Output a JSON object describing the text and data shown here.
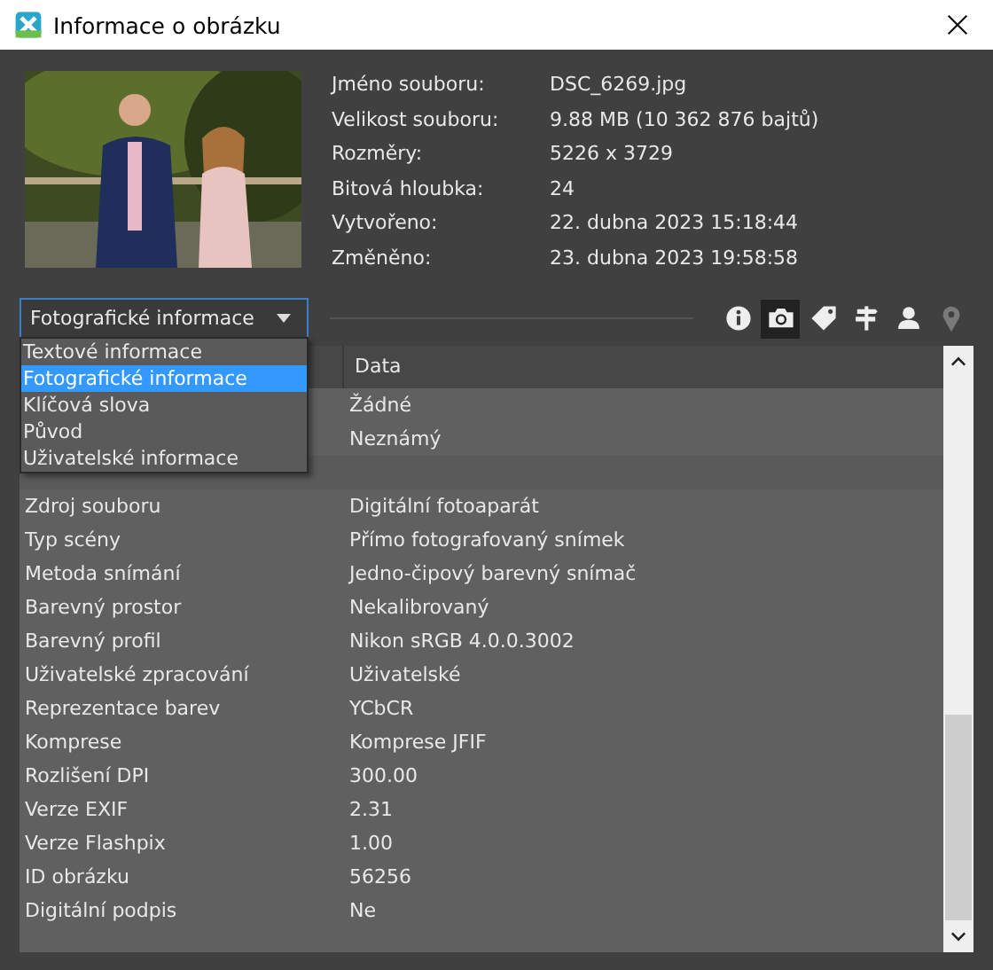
{
  "window": {
    "title": "Informace o obrázku"
  },
  "file_info": [
    {
      "label": "Jméno souboru:",
      "value": "DSC_6269.jpg"
    },
    {
      "label": "Velikost souboru:",
      "value": "9.88 MB (10 362 876 bajtů)"
    },
    {
      "label": "Rozměry:",
      "value": "5226 x 3729"
    },
    {
      "label": "Bitová hloubka:",
      "value": "24"
    },
    {
      "label": "Vytvořeno:",
      "value": "22. dubna 2023 15:18:44"
    },
    {
      "label": "Změněno:",
      "value": "23. dubna 2023 19:58:58"
    }
  ],
  "category_dropdown": {
    "value": "Fotografické informace",
    "expanded": true,
    "options": [
      {
        "label": "Textové informace",
        "selected": false
      },
      {
        "label": "Fotografické informace",
        "selected": true
      },
      {
        "label": "Klíčová slova",
        "selected": false
      },
      {
        "label": "Původ",
        "selected": false
      },
      {
        "label": "Uživatelské informace",
        "selected": false
      }
    ]
  },
  "toolbar": [
    {
      "kind": "info",
      "selected": false,
      "disabled": false
    },
    {
      "kind": "camera",
      "selected": true,
      "disabled": false
    },
    {
      "kind": "tag",
      "selected": false,
      "disabled": false
    },
    {
      "kind": "signpost",
      "selected": false,
      "disabled": false
    },
    {
      "kind": "person",
      "selected": false,
      "disabled": false
    },
    {
      "kind": "pin",
      "selected": false,
      "disabled": true
    }
  ],
  "table": {
    "columns": [
      "Data"
    ],
    "rows": [
      {
        "kind": "item",
        "value": "Žádné"
      },
      {
        "kind": "item",
        "value": "Neznámý"
      },
      {
        "kind": "section"
      },
      {
        "kind": "item",
        "label": "Zdroj souboru",
        "value": "Digitální fotoaparát"
      },
      {
        "kind": "item",
        "label": "Typ scény",
        "value": "Přímo fotografovaný snímek"
      },
      {
        "kind": "item",
        "label": "Metoda snímání",
        "value": "Jedno-čipový barevný snímač"
      },
      {
        "kind": "item",
        "label": "Barevný prostor",
        "value": "Nekalibrovaný"
      },
      {
        "kind": "item",
        "label": "Barevný profil",
        "value": "Nikon sRGB 4.0.0.3002"
      },
      {
        "kind": "item",
        "label": "Uživatelské zpracování",
        "value": "Uživatelské"
      },
      {
        "kind": "item",
        "label": "Reprezentace barev",
        "value": "YCbCR"
      },
      {
        "kind": "item",
        "label": "Komprese",
        "value": "Komprese JFIF"
      },
      {
        "kind": "item",
        "label": "Rozlišení DPI",
        "value": "300.00"
      },
      {
        "kind": "item",
        "label": "Verze EXIF",
        "value": "2.31"
      },
      {
        "kind": "item",
        "label": "Verze Flashpix",
        "value": "1.00"
      },
      {
        "kind": "item",
        "label": "ID obrázku",
        "value": "56256"
      },
      {
        "kind": "item",
        "label": "Digitální podpis",
        "value": "Ne"
      }
    ]
  }
}
